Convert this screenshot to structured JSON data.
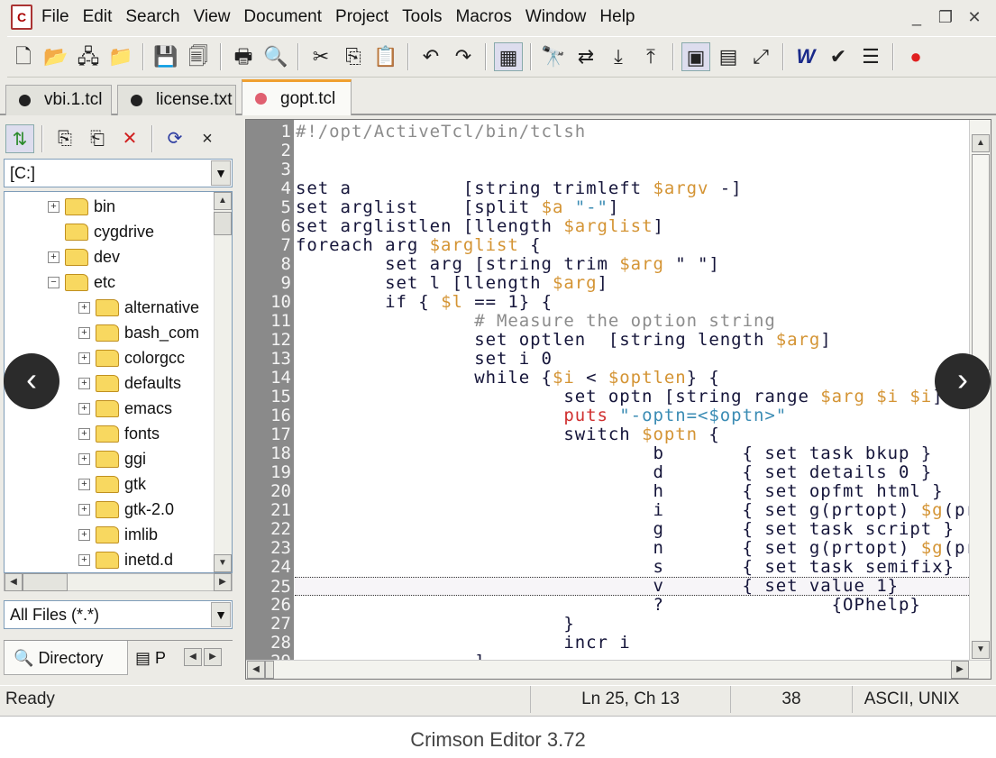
{
  "window": {
    "app_icon": "crimson-editor-icon",
    "controls": [
      "_",
      "❐",
      "✕"
    ]
  },
  "menu": [
    "File",
    "Edit",
    "Search",
    "View",
    "Document",
    "Project",
    "Tools",
    "Macros",
    "Window",
    "Help"
  ],
  "toolbar": {
    "groups": [
      [
        "new-file-icon",
        "open-file-icon",
        "open-remote-icon",
        "reopen-icon"
      ],
      [
        "save-icon",
        "save-all-icon"
      ],
      [
        "print-icon",
        "print-preview-icon"
      ],
      [
        "cut-icon",
        "copy-icon",
        "paste-icon"
      ],
      [
        "undo-icon",
        "redo-icon"
      ],
      [
        "column-mode-icon"
      ],
      [
        "find-icon",
        "replace-icon",
        "find-next-icon",
        "find-prev-icon"
      ],
      [
        "directory-window-icon",
        "output-window-icon",
        "fullscreen-icon"
      ],
      [
        "word-wrap-icon",
        "spell-check-icon",
        "line-numbers-icon"
      ],
      [
        "record-macro-icon"
      ]
    ]
  },
  "tabs": [
    {
      "label": "vbi.1.tcl",
      "active": false
    },
    {
      "label": "license.txt",
      "active": false
    },
    {
      "label": "gopt.tcl",
      "active": true
    }
  ],
  "left_panel": {
    "toolbar": [
      "sync-icon",
      "copy-icon",
      "move-icon",
      "delete-icon",
      "refresh-icon",
      "close-icon"
    ],
    "drive": "[C:]",
    "tree": [
      {
        "label": "bin",
        "level": 1,
        "expander": "+"
      },
      {
        "label": "cygdrive",
        "level": 1,
        "expander": ""
      },
      {
        "label": "dev",
        "level": 1,
        "expander": "+"
      },
      {
        "label": "etc",
        "level": 1,
        "expander": "−"
      },
      {
        "label": "alternative",
        "level": 2,
        "expander": "+"
      },
      {
        "label": "bash_com",
        "level": 2,
        "expander": "+"
      },
      {
        "label": "colorgcc",
        "level": 2,
        "expander": "+"
      },
      {
        "label": "defaults",
        "level": 2,
        "expander": "+"
      },
      {
        "label": "emacs",
        "level": 2,
        "expander": "+"
      },
      {
        "label": "fonts",
        "level": 2,
        "expander": "+"
      },
      {
        "label": "ggi",
        "level": 2,
        "expander": "+"
      },
      {
        "label": "gtk",
        "level": 2,
        "expander": "+"
      },
      {
        "label": "gtk-2.0",
        "level": 2,
        "expander": "+"
      },
      {
        "label": "imlib",
        "level": 2,
        "expander": "+"
      },
      {
        "label": "inetd.d",
        "level": 2,
        "expander": "+"
      }
    ],
    "filter": "All Files (*.*)",
    "bottom_tabs": [
      {
        "label": "Directory",
        "icon": "directory-icon"
      },
      {
        "label": "P",
        "icon": "project-icon"
      }
    ]
  },
  "editor": {
    "current_line": 25,
    "colors": {
      "keyword": "#15153a",
      "variable": "#d49434",
      "string": "#3b8cb4",
      "comment": "#8c8c8c",
      "command": "#d03030"
    },
    "lines": [
      [
        [
          "#!/opt/ActiveTcl/bin/tclsh",
          "c"
        ]
      ],
      [],
      [],
      [
        [
          "set a          [string trimleft ",
          ""
        ],
        [
          "$argv",
          "v"
        ],
        [
          " -]",
          ""
        ]
      ],
      [
        [
          "set arglist    [split ",
          ""
        ],
        [
          "$a",
          "v"
        ],
        [
          " ",
          ""
        ],
        [
          "\"-\"",
          "s"
        ],
        [
          "]",
          ""
        ]
      ],
      [
        [
          "set arglistlen [llength ",
          ""
        ],
        [
          "$arglist",
          "v"
        ],
        [
          "]",
          ""
        ]
      ],
      [
        [
          "foreach arg ",
          ""
        ],
        [
          "$arglist",
          "v"
        ],
        [
          " {",
          ""
        ]
      ],
      [
        [
          "        set arg [string trim ",
          ""
        ],
        [
          "$arg",
          "v"
        ],
        [
          " \" \"]",
          ""
        ]
      ],
      [
        [
          "        set l [llength ",
          ""
        ],
        [
          "$arg",
          "v"
        ],
        [
          "]",
          ""
        ]
      ],
      [
        [
          "        if { ",
          ""
        ],
        [
          "$l",
          "v"
        ],
        [
          " == 1} {",
          ""
        ]
      ],
      [
        [
          "                ",
          ""
        ],
        [
          "# Measure the option string",
          "c"
        ]
      ],
      [
        [
          "                set optlen  [string length ",
          ""
        ],
        [
          "$arg",
          "v"
        ],
        [
          "]",
          ""
        ]
      ],
      [
        [
          "                set i 0",
          ""
        ]
      ],
      [
        [
          "                while {",
          ""
        ],
        [
          "$i",
          "v"
        ],
        [
          " < ",
          ""
        ],
        [
          "$optlen",
          "v"
        ],
        [
          "} {",
          ""
        ]
      ],
      [
        [
          "                        set optn [string range ",
          ""
        ],
        [
          "$arg",
          "v"
        ],
        [
          " ",
          ""
        ],
        [
          "$i",
          "v"
        ],
        [
          " ",
          ""
        ],
        [
          "$i",
          "v"
        ],
        [
          "]",
          ""
        ]
      ],
      [
        [
          "                        ",
          ""
        ],
        [
          "puts",
          "r"
        ],
        [
          " ",
          ""
        ],
        [
          "\"-optn=<$optn>\"",
          "s"
        ]
      ],
      [
        [
          "                        switch ",
          ""
        ],
        [
          "$optn",
          "v"
        ],
        [
          " {",
          ""
        ]
      ],
      [
        [
          "                                b       { set task bkup }",
          ""
        ]
      ],
      [
        [
          "                                d       { set details 0 }",
          ""
        ]
      ],
      [
        [
          "                                h       { set opfmt html }",
          ""
        ]
      ],
      [
        [
          "                                i       { set g(prtopt) ",
          ""
        ],
        [
          "$g",
          "v"
        ],
        [
          "(pr",
          ""
        ]
      ],
      [
        [
          "                                g       { set task script }",
          ""
        ]
      ],
      [
        [
          "                                n       { set g(prtopt) ",
          ""
        ],
        [
          "$g",
          "v"
        ],
        [
          "(pr",
          ""
        ]
      ],
      [
        [
          "                                s       { set task semifix}",
          ""
        ]
      ],
      [
        [
          "                                v       { set value 1}",
          ""
        ]
      ],
      [
        [
          "                                ?               {OPhelp}",
          ""
        ]
      ],
      [
        [
          "                        }",
          ""
        ]
      ],
      [
        [
          "                        incr i",
          ""
        ]
      ],
      [
        [
          "                ]",
          ""
        ]
      ]
    ]
  },
  "status": {
    "message": "Ready",
    "position": "Ln 25, Ch 13",
    "count": "38",
    "encoding": "ASCII, UNIX"
  },
  "caption": "Crimson Editor 3.72",
  "carousel": {
    "prev": "‹",
    "next": "›"
  }
}
